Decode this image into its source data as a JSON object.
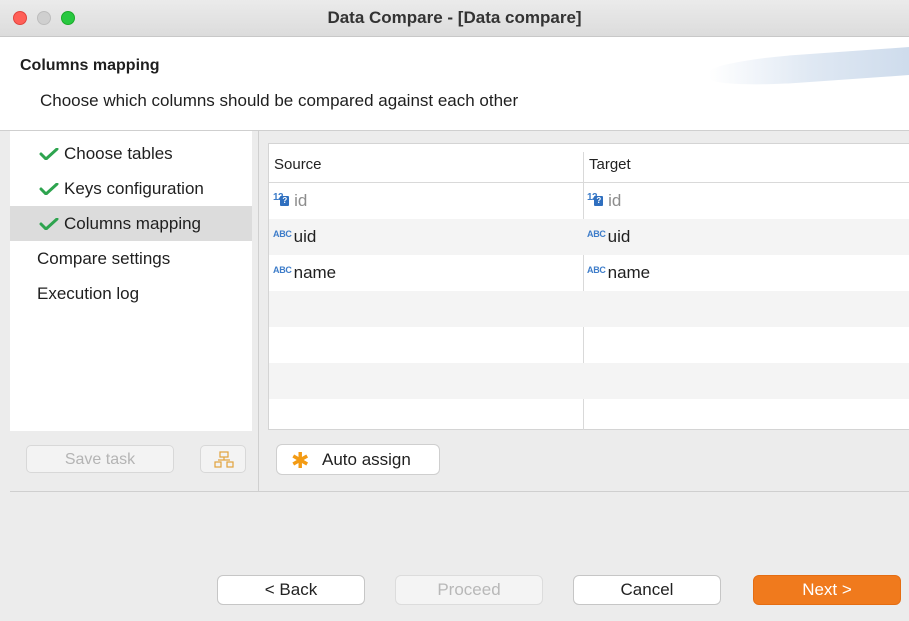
{
  "window": {
    "title": "Data Compare - [Data compare]"
  },
  "header": {
    "title": "Columns mapping",
    "description": "Choose which columns should be compared against each other"
  },
  "nav": {
    "items": [
      {
        "label": "Choose tables",
        "done": true
      },
      {
        "label": "Keys configuration",
        "done": true
      },
      {
        "label": "Columns mapping",
        "done": true,
        "selected": true
      },
      {
        "label": "Compare settings",
        "done": false
      },
      {
        "label": "Execution log",
        "done": false
      }
    ],
    "save_task_label": "Save task"
  },
  "table": {
    "headers": {
      "source": "Source",
      "target": "Target"
    },
    "rows": [
      {
        "source": "id",
        "target": "id",
        "type": "number",
        "dim": true
      },
      {
        "source": "uid",
        "target": "uid",
        "type": "string",
        "dim": false
      },
      {
        "source": "name",
        "target": "name",
        "type": "string",
        "dim": false
      }
    ]
  },
  "auto_assign_label": "Auto assign",
  "footer": {
    "back": "< Back",
    "proceed": "Proceed",
    "cancel": "Cancel",
    "next": "Next >"
  },
  "colors": {
    "accent": "#f07a1d",
    "check": "#2ea44f",
    "type_icon": "#3d7cc9"
  }
}
